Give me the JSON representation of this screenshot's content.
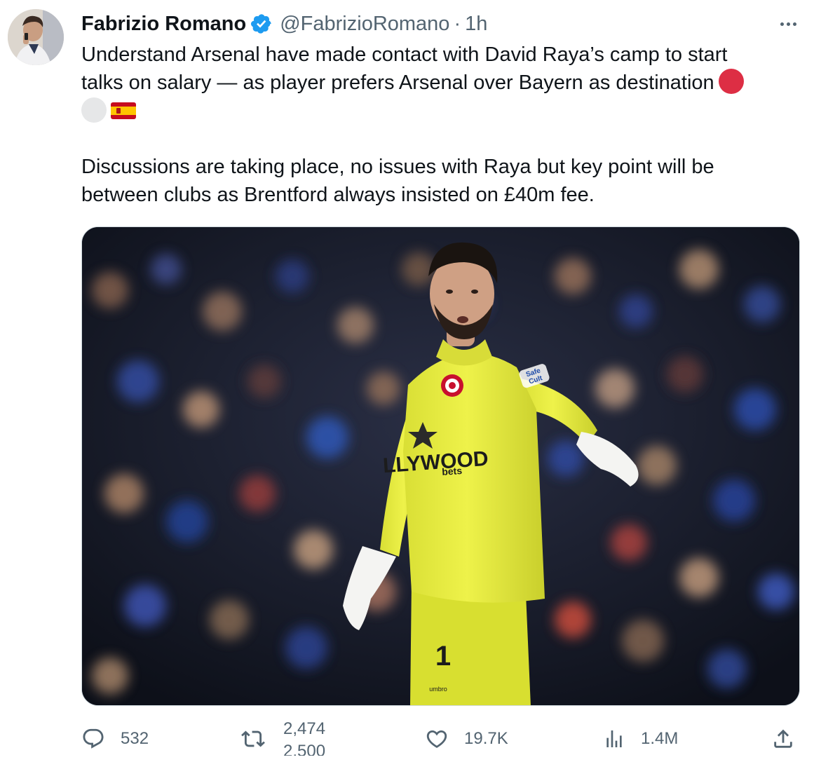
{
  "author": {
    "display_name": "Fabrizio Romano",
    "handle": "@FabrizioRomano",
    "separator": "·",
    "time": "1h",
    "verified": true
  },
  "tweet": {
    "line1": "Understand Arsenal have made contact with David Raya’s camp to start",
    "line2": "talks on salary — as player prefers Arsenal over Bayern as destination",
    "emojis": [
      "red-circle",
      "white-circle",
      "spain-flag"
    ],
    "para2_line1": "Discussions are taking place, no issues with Raya but key point will be",
    "para2_line2": "between clubs as Brentford always insisted on £40m fee."
  },
  "media": {
    "kit_sponsor_line1": "LLYWOOD",
    "kit_sponsor_line2": "bets",
    "shirt_number": "1",
    "sleeve_badge_line1": "Safe",
    "sleeve_badge_line2": "Cult",
    "kit_brand": "umbro"
  },
  "actions": {
    "replies": "532",
    "retweets": "2,474",
    "retweets_next": "2,500",
    "likes": "19.7K",
    "views": "1.4M"
  },
  "colors": {
    "verified_badge": "#1d9bf0",
    "muted_text": "#536471",
    "text": "#0f1419",
    "jersey": "#e6ec3f"
  }
}
